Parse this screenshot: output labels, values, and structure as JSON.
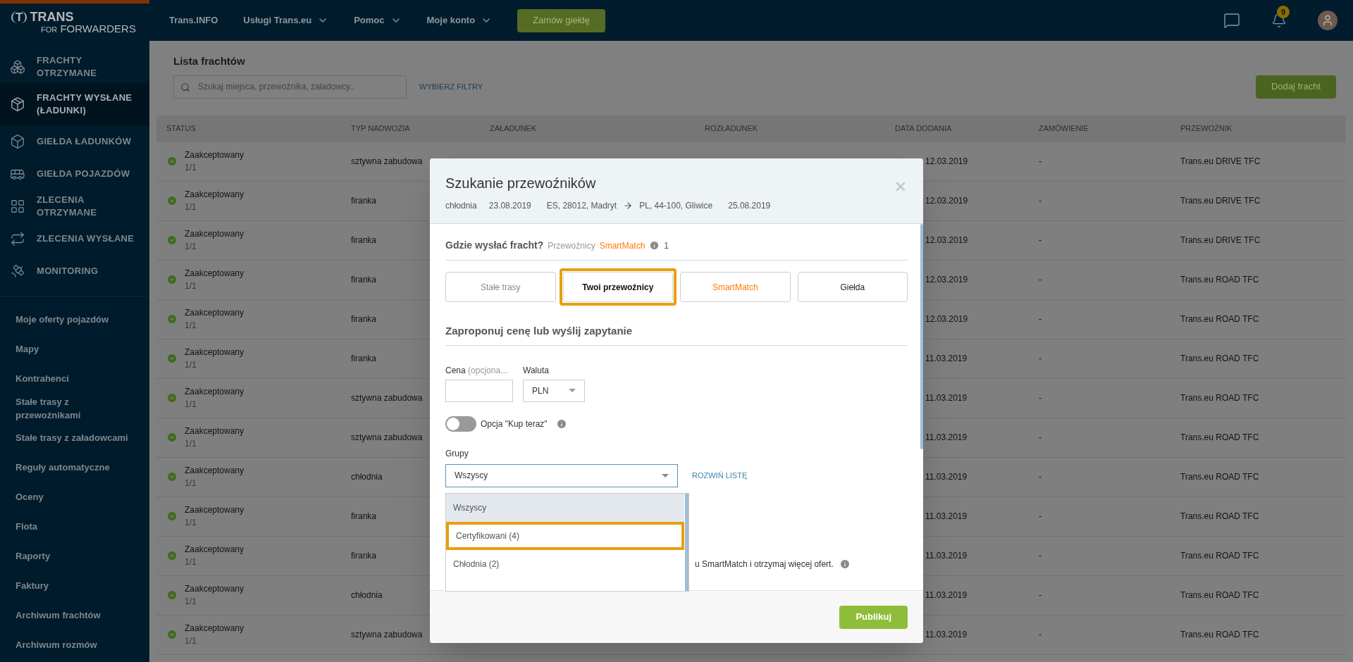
{
  "logo": {
    "mark": "T",
    "name": "TRANS",
    "sub_prefix": "FOR",
    "sub": "FORWARDERS"
  },
  "top_nav": {
    "links": [
      {
        "label": "Trans.INFO",
        "dropdown": false
      },
      {
        "label": "Usługi Trans.eu",
        "dropdown": true
      },
      {
        "label": "Pomoc",
        "dropdown": true
      },
      {
        "label": "Moje konto",
        "dropdown": true
      }
    ],
    "cta": "Zamów giełdę",
    "notifications_badge": "9"
  },
  "sidebar": {
    "items": [
      {
        "label": "FRACHTY OTRZYMANE",
        "selected": false
      },
      {
        "label": "FRACHTY WYSŁANE (ŁADUNKI)",
        "selected": true
      },
      {
        "label": "GIEŁDA ŁADUNKÓW",
        "selected": false
      },
      {
        "label": "GIEŁDA POJAZDÓW",
        "selected": false
      },
      {
        "label": "ZLECENIA OTRZYMANE",
        "selected": false
      },
      {
        "label": "ZLECENIA WYSŁANE",
        "selected": false
      },
      {
        "label": "MONITORING",
        "selected": false
      }
    ],
    "links": [
      "Moje oferty pojazdów",
      "Mapy",
      "Kontrahenci",
      "Stałe trasy z przewoźnikami",
      "Stałe trasy z załadowcami",
      "Reguły automatyczne",
      "Oceny",
      "Flota",
      "Raporty",
      "Faktury",
      "Archiwum frachtów",
      "Archiwum rozmów"
    ]
  },
  "page": {
    "title": "Lista frachtów",
    "search": {
      "placeholder": "Szukaj miejsca, przewoźnika, załadowcy.."
    },
    "filters_link": "WYBIERZ FILTRY",
    "add_button": "Dodaj fracht"
  },
  "table": {
    "columns": [
      "STATUS",
      "TYP NADWOZIA",
      "ZAŁADUNEK",
      "ROZŁADUNEK",
      "DATA DODANIA",
      "ZAMÓWIENIE",
      "PRZEWOŹNIK"
    ],
    "rows": [
      {
        "status": "Zaakceptowany",
        "progress": "1/1",
        "body_type": "sztywna zabudowa",
        "date_added": "12.03.2019",
        "order": "-",
        "carrier": "Trans.eu DRIVE TFC"
      },
      {
        "status": "Zaakceptowany",
        "progress": "1/1",
        "body_type": "firanka",
        "date_added": "12.03.2019",
        "order": "-",
        "carrier": "Trans.eu DRIVE TFC"
      },
      {
        "status": "Zaakceptowany",
        "progress": "1/1",
        "body_type": "firanka",
        "date_added": "12.03.2019",
        "order": "-",
        "carrier": "Trans.eu DRIVE TFC"
      },
      {
        "status": "Zaakceptowany",
        "progress": "1/1",
        "body_type": "firanka",
        "date_added": "12.03.2019",
        "order": "-",
        "carrier": "Trans.eu ROAD TFC"
      },
      {
        "status": "Zaakceptowany",
        "progress": "1/1",
        "body_type": "firanka",
        "date_added": "12.03.2019",
        "order": "-",
        "carrier": "Trans.eu ROAD TFC"
      },
      {
        "status": "Zaakceptowany",
        "progress": "1/1",
        "body_type": "firanka",
        "date_added": "11.03.2019",
        "order": "-",
        "carrier": "Trans.eu ROAD TFC"
      },
      {
        "status": "Zaakceptowany",
        "progress": "1/1",
        "body_type": "sztywna zabudowa",
        "date_added": "11.03.2019",
        "order": "-",
        "carrier": "Trans.eu ROAD TFC"
      },
      {
        "status": "Zaakceptowany",
        "progress": "1/1",
        "body_type": "sztywna zabudowa",
        "date_added": "11.03.2019",
        "order": "-",
        "carrier": "Trans.eu ROAD TFC"
      },
      {
        "status": "Zaakceptowany",
        "progress": "1/1",
        "body_type": "chłodnia",
        "date_added": "11.03.2019",
        "order": "-",
        "carrier": "Trans.eu ROAD TFC"
      },
      {
        "status": "Zaakceptowany",
        "progress": "1/1",
        "body_type": "firanka",
        "date_added": "11.03.2019",
        "order": "-",
        "carrier": "Trans.eu ROAD TFC"
      },
      {
        "status": "Zaakceptowany",
        "progress": "1/1",
        "body_type": "firanka",
        "date_added": "11.03.2019",
        "order": "-",
        "carrier": "Trans.eu ROAD TFC"
      },
      {
        "status": "Zaakceptowany",
        "progress": "1/1",
        "body_type": "chłodnia",
        "date_added": "11.03.2019",
        "order": "-",
        "carrier": "Trans.eu ROAD TFC"
      },
      {
        "status": "Zaakceptowany",
        "progress": "1/1",
        "body_type": "sztywna zabudowa",
        "date_added": "11.03.2019",
        "order": "-",
        "carrier": "Trans.eu ROAD TFC"
      }
    ]
  },
  "modal": {
    "title": "Szukanie przewoźników",
    "meta": {
      "body_type": "chłodnia",
      "load_date": "23.08.2019",
      "from": "ES, 28012, Madryt",
      "to": "PL, 44-100, Gliwice",
      "unload_date": "25.08.2019"
    },
    "where_heading": "Gdzie wysłać fracht?",
    "carriers_label": "Przewoźnicy",
    "smartmatch_label": "SmartMatch",
    "carriers_count": "1",
    "tabs": [
      {
        "label": "Stałe trasy",
        "selected": false,
        "highlighted": false,
        "color": "#888888"
      },
      {
        "label": "Twoi przewoźnicy",
        "selected": true,
        "highlighted": true,
        "color": "#111111"
      },
      {
        "label": "SmartMatch",
        "selected": false,
        "highlighted": false,
        "color": "#ff7a00"
      },
      {
        "label": "Giełda",
        "selected": false,
        "highlighted": false,
        "color": "#222222"
      }
    ],
    "price_heading": "Zaproponuj cenę lub wyślij zapytanie",
    "price_label": "Cena",
    "price_hint": "(opcjona...",
    "currency_label": "Waluta",
    "currency_value": "PLN",
    "buy_now": {
      "label": "Opcja \"Kup teraz\"",
      "on": false
    },
    "groups_label": "Grupy",
    "groups_select": {
      "value": "Wszyscy",
      "expanded": true
    },
    "expand_link": "ROZWIŃ LISTĘ",
    "group_options": [
      {
        "label": "Wszyscy",
        "selected": true,
        "highlighted": false
      },
      {
        "label": "Certyfikowani (4)",
        "selected": false,
        "highlighted": true
      },
      {
        "label": "Chłodnia (2)",
        "selected": false,
        "highlighted": false
      }
    ],
    "smartmatch_note": "u SmartMatch i otrzymaj więcej ofert.",
    "publish_button": "Publikuj"
  }
}
